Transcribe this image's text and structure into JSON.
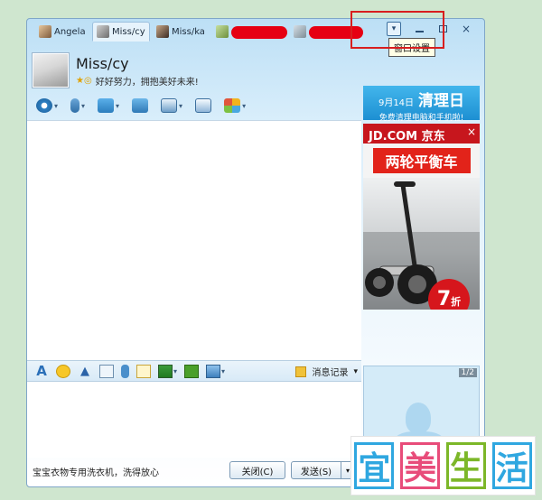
{
  "tabs": [
    {
      "label": "Angela",
      "active": false
    },
    {
      "label": "Miss/cy",
      "active": true
    },
    {
      "label": "Miss/ka",
      "active": false
    }
  ],
  "tooltip": {
    "text": "窗口设置"
  },
  "window_controls": {
    "close": "×"
  },
  "contact": {
    "name": "Miss/cy",
    "signature": "好好努力，拥抱美好未来!"
  },
  "toolbar": {
    "icons": [
      "video-call-icon",
      "voice-call-icon",
      "file-transfer-icon",
      "remote-assist-icon",
      "screen-share-icon",
      "apps-icon"
    ]
  },
  "ad_top": {
    "date": "9月14日",
    "headline": "清理日",
    "sub": "免费清理电脑和手机啦!"
  },
  "ad_jd": {
    "brand": "JD.COM 京东",
    "close": "×",
    "product": "两轮平衡车",
    "discount": "7",
    "discount_unit": "折"
  },
  "format_bar": {
    "font_glyph": "A",
    "history_label": "消息记录",
    "history_caret": "▾"
  },
  "footer": {
    "ad_text": "宝宝衣物专用洗衣机，洗得放心"
  },
  "buttons": {
    "close_label": "关闭(C)",
    "send_label": "发送(S)"
  },
  "video_panel": {
    "pager": "1/2"
  },
  "watermark": {
    "chars": [
      "宜",
      "美",
      "生",
      "活"
    ],
    "colors": [
      "#2fa7e0",
      "#e84c7a",
      "#7cb728",
      "#2fa7e0"
    ]
  }
}
